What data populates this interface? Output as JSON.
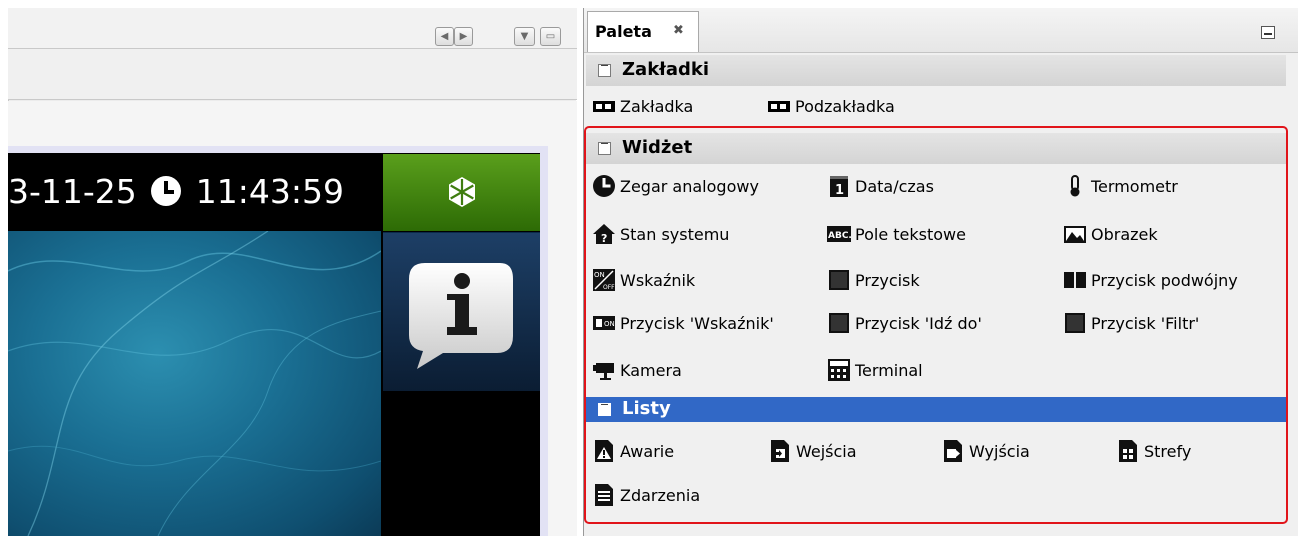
{
  "editor": {
    "datetime": {
      "date": "3-11-25",
      "time": "11:43:59"
    }
  },
  "palette": {
    "tab_label": "Paleta",
    "tab_close_icon": "x-close",
    "sections": {
      "zakladki": {
        "title": "Zakładki",
        "items": [
          "Zakładka",
          "Podzakładka"
        ]
      },
      "widzet": {
        "title": "Widżet",
        "items": [
          "Zegar analogowy",
          "Data/czas",
          "Termometr",
          "Stan systemu",
          "Pole tekstowe",
          "Obrazek",
          "Wskaźnik",
          "Przycisk",
          "Przycisk podwójny",
          "Przycisk 'Wskaźnik'",
          "Przycisk 'Idź do'",
          "Przycisk 'Filtr'",
          "Kamera",
          "Terminal"
        ]
      },
      "listy": {
        "title": "Listy",
        "items": [
          "Awarie",
          "Wejścia",
          "Wyjścia",
          "Strefy",
          "Zdarzenia"
        ]
      }
    }
  },
  "colors": {
    "selection": "#3168c6",
    "highlight_border": "#e1141a",
    "green_button": "#4a8c14"
  }
}
